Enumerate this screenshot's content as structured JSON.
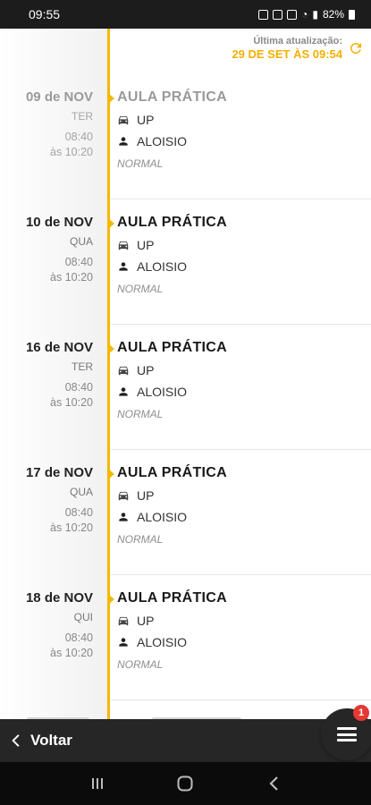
{
  "status_bar": {
    "time": "09:55",
    "battery": "82%"
  },
  "header": {
    "update_label": "Última atualização:",
    "update_value": "29 DE SET ÀS 09:54"
  },
  "entries": [
    {
      "date": "09 de NOV",
      "weekday": "TER",
      "time_start": "08:40",
      "time_end": "às 10:20",
      "title": "AULA PRÁTICA",
      "vehicle": "UP",
      "instructor": "ALOISIO",
      "note": "NORMAL"
    },
    {
      "date": "10 de NOV",
      "weekday": "QUA",
      "time_start": "08:40",
      "time_end": "às 10:20",
      "title": "AULA PRÁTICA",
      "vehicle": "UP",
      "instructor": "ALOISIO",
      "note": "NORMAL"
    },
    {
      "date": "16 de NOV",
      "weekday": "TER",
      "time_start": "08:40",
      "time_end": "às 10:20",
      "title": "AULA PRÁTICA",
      "vehicle": "UP",
      "instructor": "ALOISIO",
      "note": "NORMAL"
    },
    {
      "date": "17 de NOV",
      "weekday": "QUA",
      "time_start": "08:40",
      "time_end": "às 10:20",
      "title": "AULA PRÁTICA",
      "vehicle": "UP",
      "instructor": "ALOISIO",
      "note": "NORMAL"
    },
    {
      "date": "18 de NOV",
      "weekday": "QUI",
      "time_start": "08:40",
      "time_end": "às 10:20",
      "title": "AULA PRÁTICA",
      "vehicle": "UP",
      "instructor": "ALOISIO",
      "note": "NORMAL"
    }
  ],
  "bottom": {
    "back_label": "Voltar",
    "menu_badge": "1"
  },
  "colors": {
    "accent": "#f5b800",
    "dark": "#262626",
    "badge": "#e53935"
  }
}
